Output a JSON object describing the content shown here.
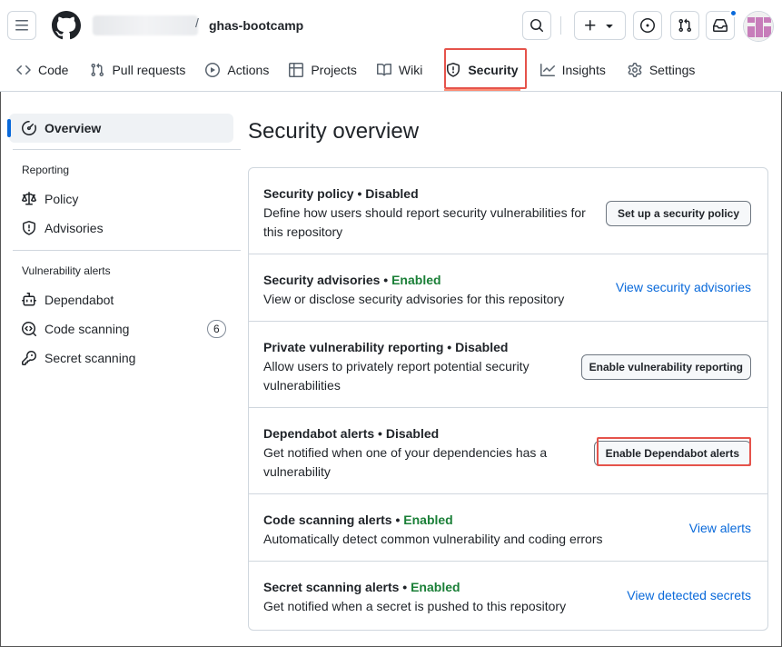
{
  "header": {
    "repo_name": "ghas-bootcamp",
    "slash": "/",
    "icons": [
      "menu-icon",
      "github-logo-icon",
      "search-icon",
      "plus-icon",
      "triangle-down-icon",
      "issue-icon",
      "pull-request-icon",
      "inbox-icon"
    ],
    "notification_color": "#0969da"
  },
  "tabs": [
    {
      "label": "Code",
      "icon": "code-icon"
    },
    {
      "label": "Pull requests",
      "icon": "pull-request-icon"
    },
    {
      "label": "Actions",
      "icon": "play-icon"
    },
    {
      "label": "Projects",
      "icon": "table-icon"
    },
    {
      "label": "Wiki",
      "icon": "book-icon"
    },
    {
      "label": "Security",
      "icon": "shield-icon",
      "active": true
    },
    {
      "label": "Insights",
      "icon": "graph-icon"
    },
    {
      "label": "Settings",
      "icon": "gear-icon"
    }
  ],
  "sidebar": {
    "overview": "Overview",
    "reporting_heading": "Reporting",
    "policy": "Policy",
    "advisories": "Advisories",
    "vuln_heading": "Vulnerability alerts",
    "dependabot": "Dependabot",
    "code_scanning": "Code scanning",
    "code_scanning_count": "6",
    "secret_scanning": "Secret scanning"
  },
  "main": {
    "title": "Security overview",
    "rows": [
      {
        "title": "Security policy",
        "sep": " • ",
        "state": "Disabled",
        "desc": "Define how users should report security vulnerabilities for this repository",
        "action": "Set up a security policy",
        "action_type": "button"
      },
      {
        "title": "Security advisories",
        "sep": " • ",
        "state": "Enabled",
        "desc": "View or disclose security advisories for this repository",
        "action": "View security advisories",
        "action_type": "link"
      },
      {
        "title": "Private vulnerability reporting",
        "sep": " • ",
        "state": "Disabled",
        "desc": "Allow users to privately report potential security vulnerabilities",
        "action": "Enable vulnerability reporting",
        "action_type": "button"
      },
      {
        "title": "Dependabot alerts",
        "sep": " • ",
        "state": "Disabled",
        "desc": "Get notified when one of your dependencies has a vulnerability",
        "action": "Enable Dependabot alerts",
        "action_type": "button"
      },
      {
        "title": "Code scanning alerts",
        "sep": " • ",
        "state": "Enabled",
        "desc": "Automatically detect common vulnerability and coding errors",
        "action": "View alerts",
        "action_type": "link"
      },
      {
        "title": "Secret scanning alerts",
        "sep": " • ",
        "state": "Enabled",
        "desc": "Get notified when a secret is pushed to this repository",
        "action": "View detected secrets",
        "action_type": "link"
      }
    ]
  },
  "colors": {
    "enabled": "#1a7f37",
    "link": "#0969da",
    "highlight_box": "#e5534b",
    "active_tab_underline": "#fd8c73"
  }
}
